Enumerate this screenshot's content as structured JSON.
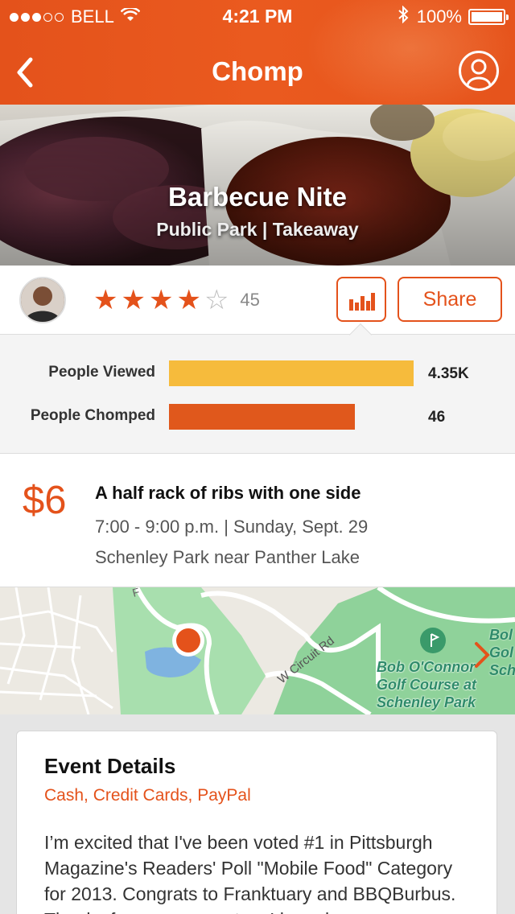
{
  "status_bar": {
    "carrier": "BELL",
    "signal_bars_filled": 3,
    "signal_bars_total": 5,
    "time": "4:21 PM",
    "battery": "100%",
    "icons": [
      "wifi-icon",
      "bluetooth-icon",
      "battery-icon"
    ]
  },
  "nav": {
    "title": "Chomp",
    "icons": [
      "back-chevron-icon",
      "profile-icon"
    ]
  },
  "hero": {
    "name": "Barbecue Nite",
    "subtitle": "Public Park | Takeaway"
  },
  "rating": {
    "stars": 4,
    "max_stars": 5,
    "count": "45"
  },
  "actions": {
    "share_label": "Share",
    "stats_icon": "bar-chart-icon"
  },
  "stats": [
    {
      "label": "People Viewed",
      "value": "4.35K",
      "fraction": 1.0,
      "color": "#f6bb3c"
    },
    {
      "label": "People Chomped",
      "value": "46",
      "fraction": 0.76,
      "color": "#e0581c"
    }
  ],
  "deal": {
    "price": "$6",
    "headline": "A half rack of ribs with one side",
    "when": "7:00 - 9:00 p.m. | Sunday, Sept. 29",
    "where": "Schenley Park near Panther Lake"
  },
  "map": {
    "road_label": "W Circuit Rd",
    "course_label_1": "Bob O'Connor",
    "course_label_2": "Golf Course at",
    "course_label_3": "Schenley Park",
    "edge_label_1": "Bol",
    "edge_label_2": "Gol",
    "edge_label_3": "Sch",
    "road_letter": "F",
    "icons": [
      "map-pin-icon",
      "golf-icon",
      "chevron-right-icon"
    ]
  },
  "event": {
    "title": "Event Details",
    "payments": "Cash, Credit Cards, PayPal",
    "description": "I’m excited that I've been voted #1 in Pittsburgh Magazine's Readers' Poll \"Mobile Food\" Category for 2013. Congrats to Franktuary and BBQBurbus. Thanks  for your support as I have been"
  },
  "colors": {
    "accent": "#e4521b",
    "viewed_bar": "#f6bb3c",
    "chomped_bar": "#e0581c",
    "map_green": "#8fd29a"
  }
}
